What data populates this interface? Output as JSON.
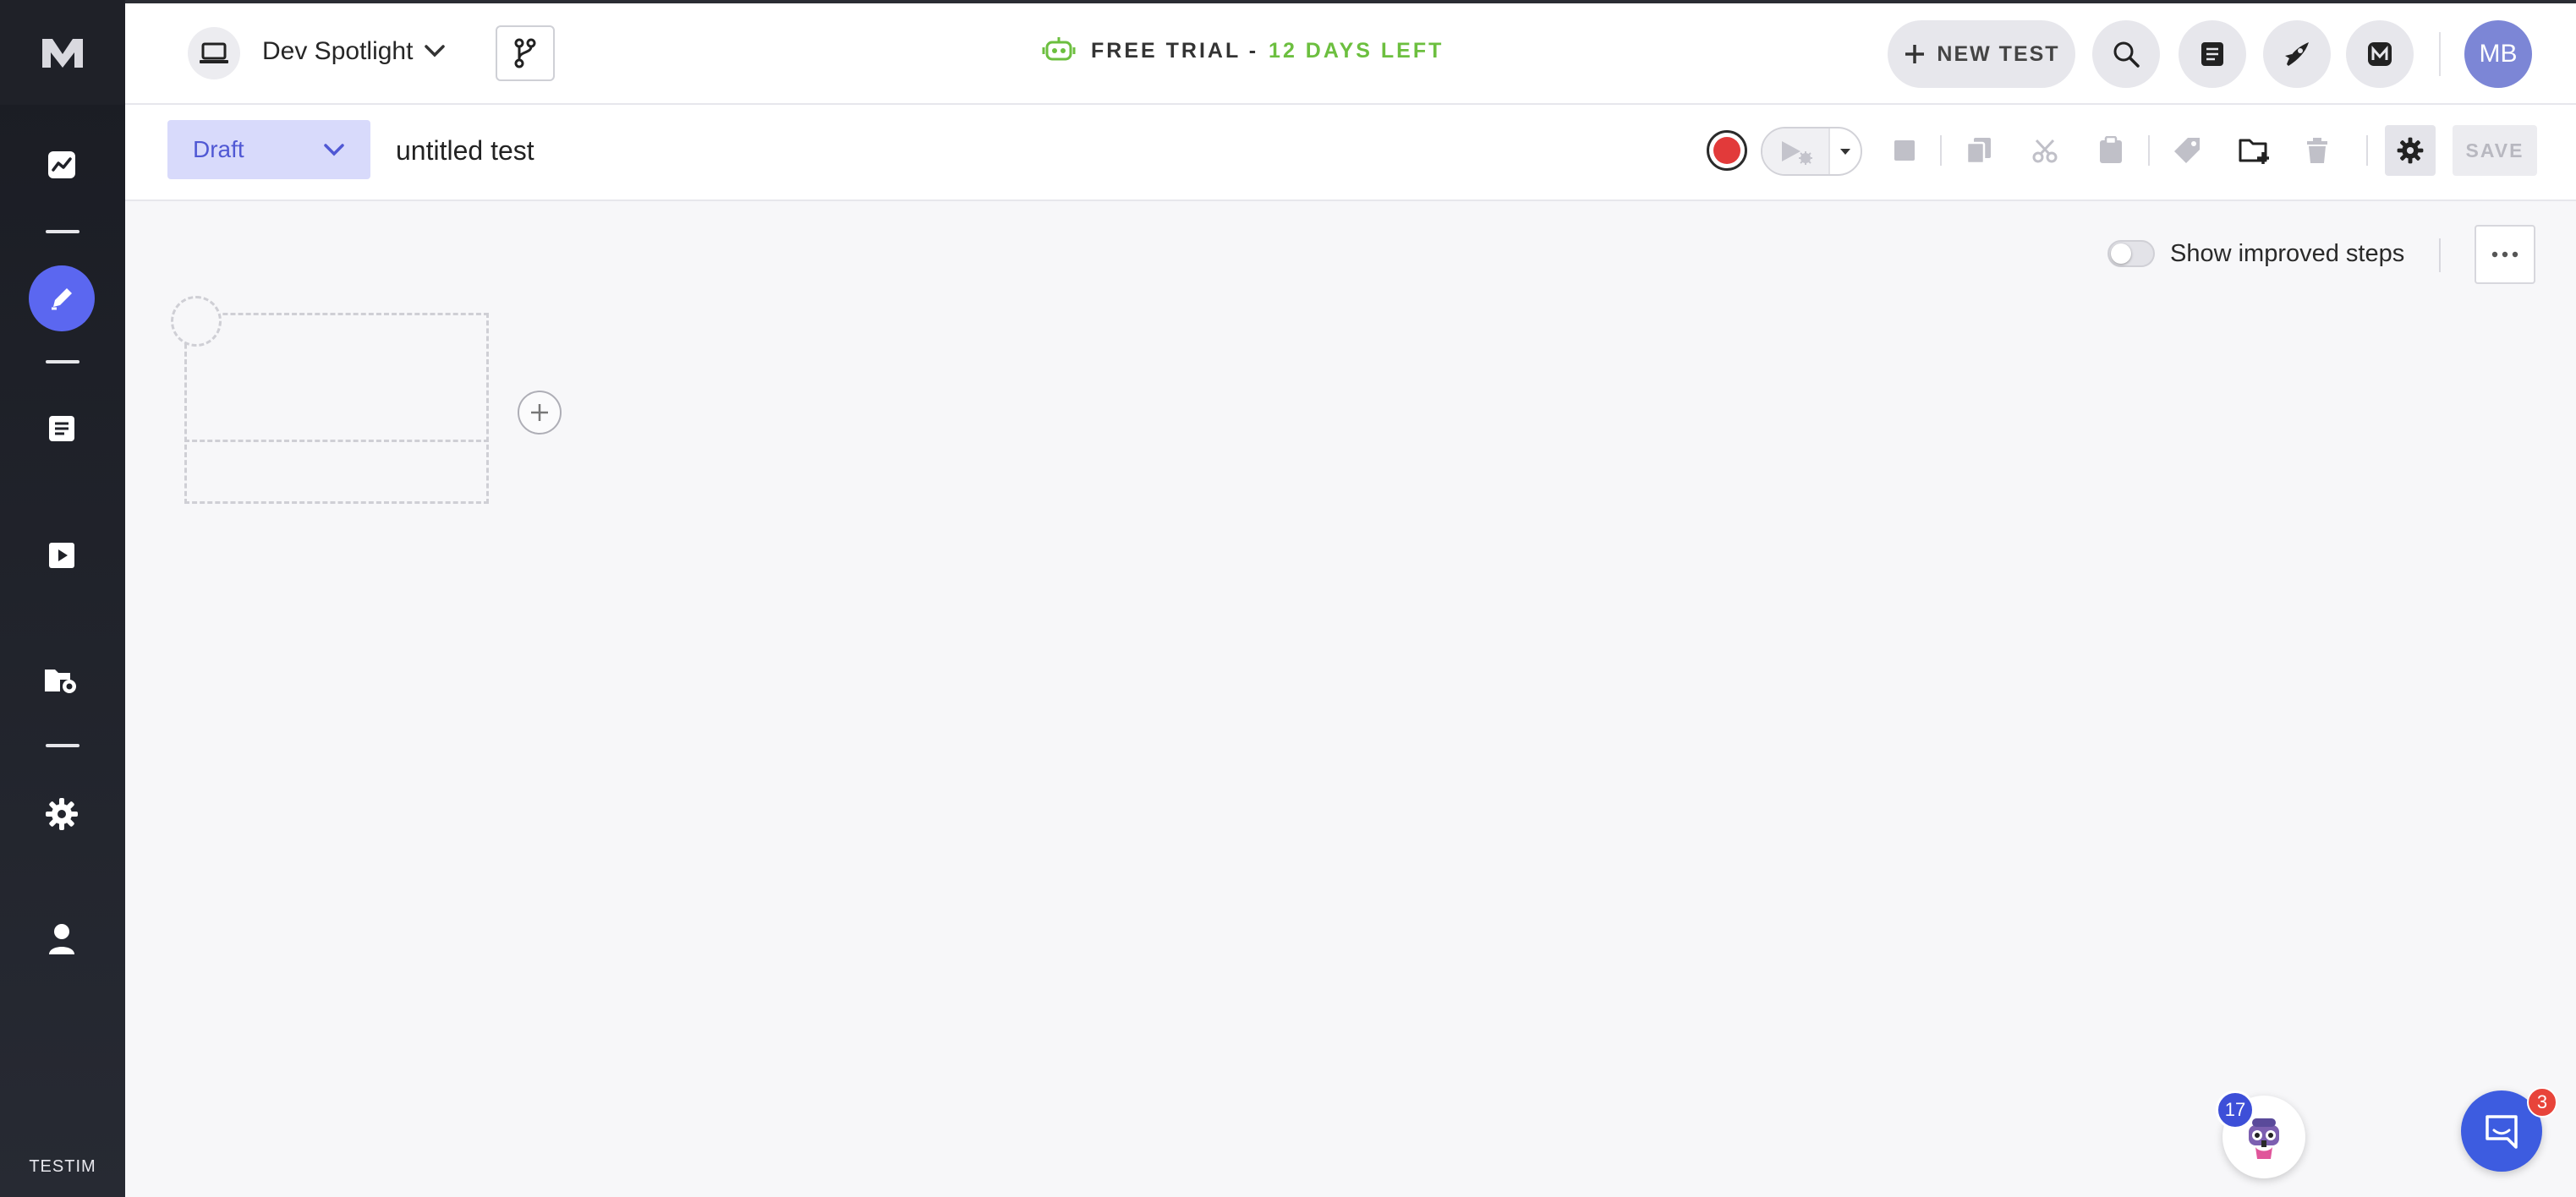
{
  "rail": {
    "logo": "M",
    "brand": "TESTIM",
    "items": [
      {
        "name": "dashboard-icon"
      },
      {
        "name": "editor-icon",
        "active": true
      },
      {
        "name": "test-list-icon"
      },
      {
        "name": "runs-icon"
      },
      {
        "name": "project-settings-icon"
      },
      {
        "name": "settings-icon"
      },
      {
        "name": "account-icon"
      }
    ]
  },
  "header": {
    "project": "Dev Spotlight",
    "trial_prefix": "FREE TRIAL -",
    "trial_days": "12 DAYS LEFT",
    "new_test_label": "NEW TEST",
    "avatar_initials": "MB",
    "icons": [
      "laptop-icon",
      "branch-icon",
      "search-icon",
      "docs-icon",
      "release-notes-icon",
      "m-app-icon"
    ]
  },
  "toolbar": {
    "status": "Draft",
    "test_name": "untitled test",
    "save_label": "SAVE",
    "record_color": "#e23a3a"
  },
  "canvas": {
    "toggle_label": "Show improved steps",
    "toggle_on": false
  },
  "widgets": {
    "bot_badge": "17",
    "chat_badge": "3"
  },
  "colors": {
    "accent": "#5b67f0",
    "trial_green": "#6cbf3f",
    "draft_bg": "#d8dafb",
    "rail_bg": "#1f2128"
  }
}
